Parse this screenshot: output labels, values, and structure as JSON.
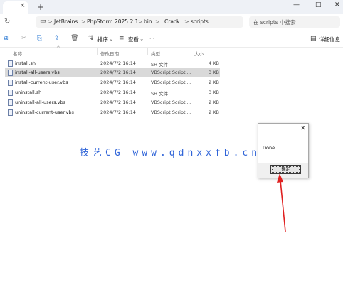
{
  "window": {
    "tab_add": "+",
    "tab_close": "×",
    "min": "—",
    "max": "□",
    "close": "✕"
  },
  "address": {
    "crumbs": [
      "JetBrains",
      "PhpStorm 2025.2.1",
      "bin",
      "Crack",
      "scripts"
    ],
    "separator": ">",
    "more": "···",
    "search_placeholder": "在 scripts 中搜索"
  },
  "toolbar": {
    "sort_label": "排序",
    "view_label": "查看",
    "more": "···",
    "details_label": "详细信息"
  },
  "files": {
    "headers": {
      "name": "名称",
      "modified": "修改日期",
      "type": "类型",
      "size": "大小"
    },
    "rows": [
      {
        "name": "install.sh",
        "modified": "2024/7/2 16:14",
        "type": "SH 文件",
        "size": "4 KB"
      },
      {
        "name": "install-all-users.vbs",
        "modified": "2024/7/2 16:14",
        "type": "VBScript Script ...",
        "size": "3 KB"
      },
      {
        "name": "install-current-user.vbs",
        "modified": "2024/7/2 16:14",
        "type": "VBScript Script ...",
        "size": "2 KB"
      },
      {
        "name": "uninstall.sh",
        "modified": "2024/7/2 16:14",
        "type": "SH 文件",
        "size": "3 KB"
      },
      {
        "name": "uninstall-all-users.vbs",
        "modified": "2024/7/2 16:14",
        "type": "VBScript Script ...",
        "size": "2 KB"
      },
      {
        "name": "uninstall-current-user.vbs",
        "modified": "2024/7/2 16:14",
        "type": "VBScript Script ...",
        "size": "2 KB"
      }
    ]
  },
  "watermark": "技艺CG www.qdnxxfb.cn",
  "dialog": {
    "close": "✕",
    "message": "Done.",
    "ok_label": "确定"
  },
  "colors": {
    "accent": "#1a6fd0",
    "selected_row": "#d9d9d9",
    "watermark": "#2f64d8",
    "arrow": "#e02020"
  }
}
